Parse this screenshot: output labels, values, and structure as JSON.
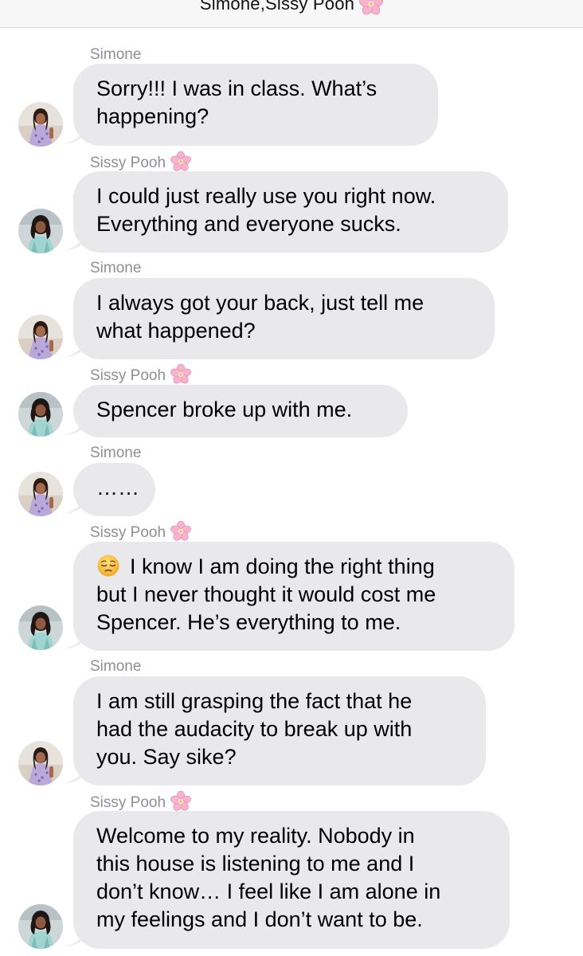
{
  "header": {
    "title": "Simone,Sissy Pooh",
    "title_icon": "cherry-blossom-emoji"
  },
  "colors": {
    "bubble": "#e9e9eb",
    "sender_text": "#8e8e93",
    "header_bg": "#f7f7f8"
  },
  "messages": [
    {
      "sender": "Simone",
      "sender_emoji": "",
      "avatar": "simone-avatar",
      "lines": [
        "Sorry!!! I was in class. What’s",
        "happening?"
      ]
    },
    {
      "sender": "Sissy Pooh",
      "sender_emoji": "cherry-blossom-emoji",
      "avatar": "sissy-pooh-avatar",
      "lines": [
        "I could just really use you right now.",
        "Everything and everyone sucks."
      ]
    },
    {
      "sender": "Simone",
      "sender_emoji": "",
      "avatar": "simone-avatar",
      "lines": [
        "I always got your back, just tell me",
        "what happened?"
      ]
    },
    {
      "sender": "Sissy Pooh",
      "sender_emoji": "cherry-blossom-emoji",
      "avatar": "sissy-pooh-avatar",
      "lines": [
        "Spencer broke up with me."
      ]
    },
    {
      "sender": "Simone",
      "sender_emoji": "",
      "avatar": "simone-avatar",
      "lines": [
        "……"
      ]
    },
    {
      "sender": "Sissy Pooh",
      "sender_emoji": "cherry-blossom-emoji",
      "avatar": "sissy-pooh-avatar",
      "lead_emoji": "pensive-face-emoji",
      "lines": [
        "I know I am doing the right thing",
        "but I never thought it would cost me",
        "Spencer. He’s everything to me."
      ]
    },
    {
      "sender": "Simone",
      "sender_emoji": "",
      "avatar": "simone-avatar",
      "lines": [
        "I am still grasping the fact that he",
        "had the audacity to break up with",
        "you. Say sike?"
      ]
    },
    {
      "sender": "Sissy Pooh",
      "sender_emoji": "cherry-blossom-emoji",
      "avatar": "sissy-pooh-avatar",
      "lines": [
        "Welcome to my reality. Nobody in",
        "this house is listening to me and I",
        "don’t know… I feel like I am alone in",
        "my feelings and I don’t want to be."
      ]
    }
  ]
}
